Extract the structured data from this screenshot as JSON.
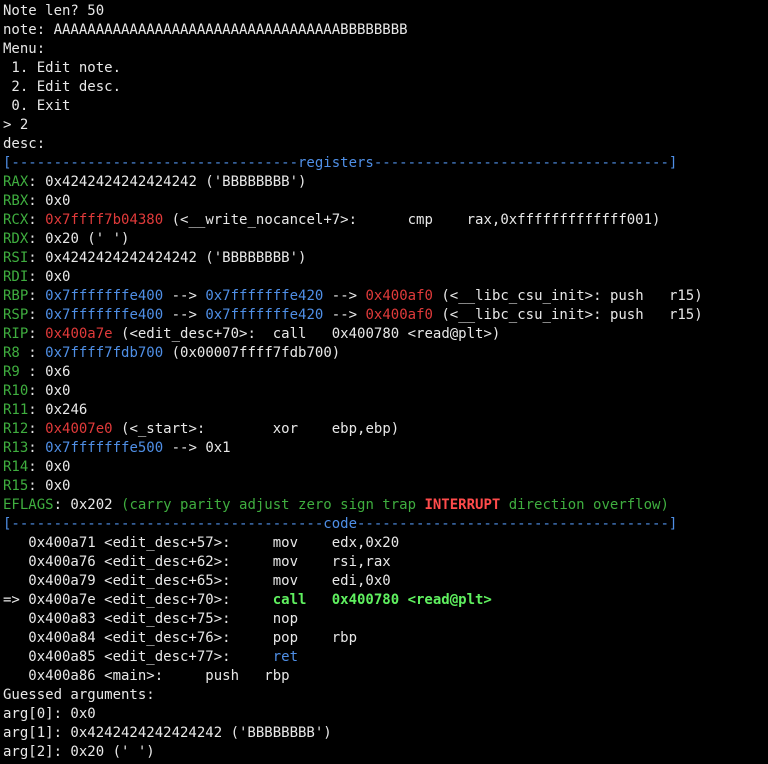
{
  "palette": {
    "default": "#e8e8e8",
    "register_name": "#3fae3f",
    "code_address": "#e03a3a",
    "stack_address": "#4f8fe6",
    "current_instruction": "#5ff05f",
    "flag_set": "#ff4b4b",
    "background": "#000000"
  },
  "lines": [
    [
      {
        "t": "Note len? 50",
        "c": "default"
      }
    ],
    [
      {
        "t": "note: AAAAAAAAAAAAAAAAAAAAAAAAAAAAAAAAAABBBBBBBB",
        "c": "default"
      }
    ],
    [
      {
        "t": "Menu:",
        "c": "default"
      }
    ],
    [
      {
        "t": " 1. Edit note.",
        "c": "default"
      }
    ],
    [
      {
        "t": " 2. Edit desc.",
        "c": "default"
      }
    ],
    [
      {
        "t": " 0. Exit",
        "c": "default"
      }
    ],
    [
      {
        "t": "> 2",
        "c": "default"
      }
    ],
    [
      {
        "t": "desc:",
        "c": "default"
      }
    ],
    [
      {
        "t": "[----------------------------------registers-----------------------------------]",
        "c": "blue"
      }
    ],
    [
      {
        "t": "RAX",
        "c": "green"
      },
      {
        "t": ": 0x4242424242424242 ('BBBBBBBB')",
        "c": "default"
      }
    ],
    [
      {
        "t": "RBX",
        "c": "green"
      },
      {
        "t": ": 0x0",
        "c": "default"
      }
    ],
    [
      {
        "t": "RCX",
        "c": "green"
      },
      {
        "t": ": ",
        "c": "default"
      },
      {
        "t": "0x7ffff7b04380",
        "c": "red"
      },
      {
        "t": " (<__write_nocancel+7>:      cmp    rax,0xfffffffffffff001)",
        "c": "default"
      }
    ],
    [
      {
        "t": "RDX",
        "c": "green"
      },
      {
        "t": ": 0x20 (' ')",
        "c": "default"
      }
    ],
    [
      {
        "t": "RSI",
        "c": "green"
      },
      {
        "t": ": 0x4242424242424242 ('BBBBBBBB')",
        "c": "default"
      }
    ],
    [
      {
        "t": "RDI",
        "c": "green"
      },
      {
        "t": ": 0x0",
        "c": "default"
      }
    ],
    [
      {
        "t": "RBP",
        "c": "green"
      },
      {
        "t": ": ",
        "c": "default"
      },
      {
        "t": "0x7fffffffe400",
        "c": "blue"
      },
      {
        "t": " --> ",
        "c": "default"
      },
      {
        "t": "0x7fffffffe420",
        "c": "blue"
      },
      {
        "t": " --> ",
        "c": "default"
      },
      {
        "t": "0x400af0",
        "c": "red"
      },
      {
        "t": " (<__libc_csu_init>: push   r15)",
        "c": "default"
      }
    ],
    [
      {
        "t": "RSP",
        "c": "green"
      },
      {
        "t": ": ",
        "c": "default"
      },
      {
        "t": "0x7fffffffe400",
        "c": "blue"
      },
      {
        "t": " --> ",
        "c": "default"
      },
      {
        "t": "0x7fffffffe420",
        "c": "blue"
      },
      {
        "t": " --> ",
        "c": "default"
      },
      {
        "t": "0x400af0",
        "c": "red"
      },
      {
        "t": " (<__libc_csu_init>: push   r15)",
        "c": "default"
      }
    ],
    [
      {
        "t": "RIP",
        "c": "green"
      },
      {
        "t": ": ",
        "c": "default"
      },
      {
        "t": "0x400a7e",
        "c": "red"
      },
      {
        "t": " (<edit_desc+70>:  call   0x400780 <read@plt>)",
        "c": "default"
      }
    ],
    [
      {
        "t": "R8 ",
        "c": "green"
      },
      {
        "t": ": ",
        "c": "default"
      },
      {
        "t": "0x7ffff7fdb700",
        "c": "blue"
      },
      {
        "t": " (0x00007ffff7fdb700)",
        "c": "default"
      }
    ],
    [
      {
        "t": "R9 ",
        "c": "green"
      },
      {
        "t": ": 0x6",
        "c": "default"
      }
    ],
    [
      {
        "t": "R10",
        "c": "green"
      },
      {
        "t": ": 0x0",
        "c": "default"
      }
    ],
    [
      {
        "t": "R11",
        "c": "green"
      },
      {
        "t": ": 0x246",
        "c": "default"
      }
    ],
    [
      {
        "t": "R12",
        "c": "green"
      },
      {
        "t": ": ",
        "c": "default"
      },
      {
        "t": "0x4007e0",
        "c": "red"
      },
      {
        "t": " (<_start>:        xor    ebp,ebp)",
        "c": "default"
      }
    ],
    [
      {
        "t": "R13",
        "c": "green"
      },
      {
        "t": ": ",
        "c": "default"
      },
      {
        "t": "0x7fffffffe500",
        "c": "blue"
      },
      {
        "t": " --> 0x1",
        "c": "default"
      }
    ],
    [
      {
        "t": "R14",
        "c": "green"
      },
      {
        "t": ": 0x0",
        "c": "default"
      }
    ],
    [
      {
        "t": "R15",
        "c": "green"
      },
      {
        "t": ": 0x0",
        "c": "default"
      }
    ],
    [
      {
        "t": "EFLAGS",
        "c": "green"
      },
      {
        "t": ": 0x202 ",
        "c": "default"
      },
      {
        "t": "(carry parity adjust zero sign trap ",
        "c": "green"
      },
      {
        "t": "INTERRUPT",
        "c": "bred"
      },
      {
        "t": " direction overflow)",
        "c": "green"
      }
    ],
    [
      {
        "t": "[-------------------------------------code-------------------------------------]",
        "c": "blue"
      }
    ],
    [
      {
        "t": "   0x400a71 <edit_desc+57>:     mov    edx,0x20",
        "c": "default"
      }
    ],
    [
      {
        "t": "   0x400a76 <edit_desc+62>:     mov    rsi,rax",
        "c": "default"
      }
    ],
    [
      {
        "t": "   0x400a79 <edit_desc+65>:     mov    edi,0x0",
        "c": "default"
      }
    ],
    [
      {
        "t": "=> 0x400a7e <edit_desc+70>:     ",
        "c": "default"
      },
      {
        "t": "call   0x400780 <read@plt>",
        "c": "bgreen"
      }
    ],
    [
      {
        "t": "   0x400a83 <edit_desc+75>:     nop",
        "c": "default"
      }
    ],
    [
      {
        "t": "   0x400a84 <edit_desc+76>:     pop    rbp",
        "c": "default"
      }
    ],
    [
      {
        "t": "   0x400a85 <edit_desc+77>:     ",
        "c": "default"
      },
      {
        "t": "ret",
        "c": "blue"
      }
    ],
    [
      {
        "t": "   0x400a86 <main>:     push   rbp",
        "c": "default"
      }
    ],
    [
      {
        "t": "Guessed arguments:",
        "c": "default"
      }
    ],
    [
      {
        "t": "arg[0]: 0x0",
        "c": "default"
      }
    ],
    [
      {
        "t": "arg[1]: 0x4242424242424242 ('BBBBBBBB')",
        "c": "default"
      }
    ],
    [
      {
        "t": "arg[2]: 0x20 (' ')",
        "c": "default"
      }
    ]
  ]
}
